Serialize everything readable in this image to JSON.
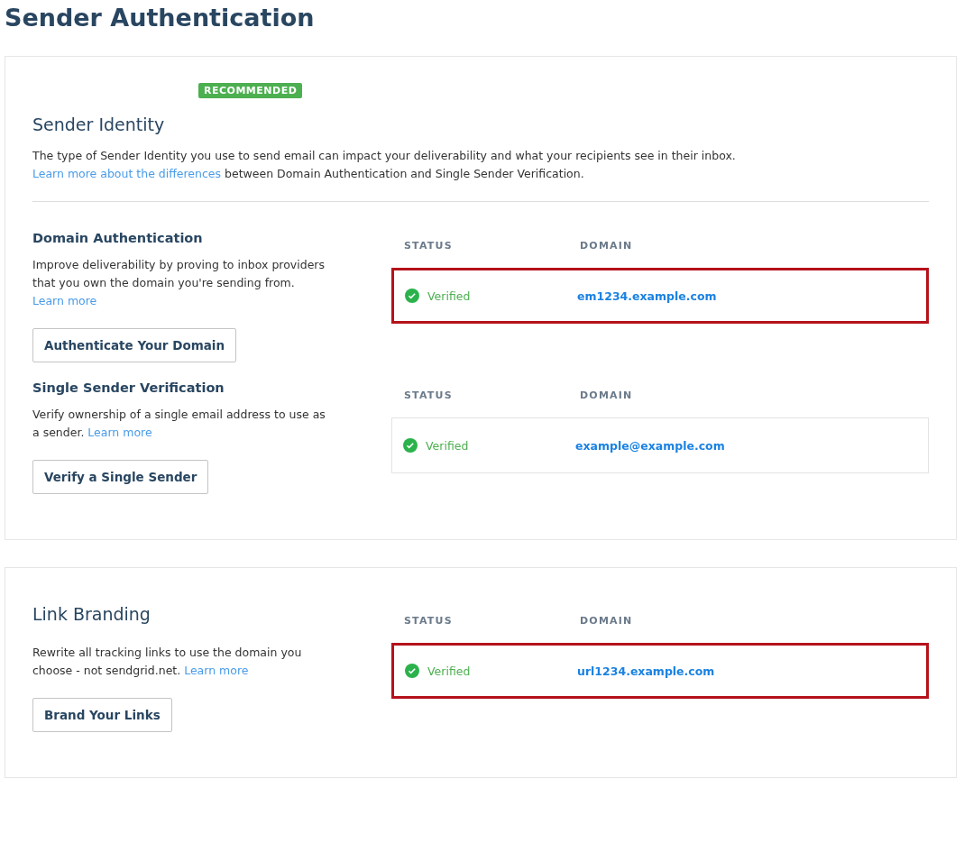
{
  "title": "Sender Authentication",
  "cards": [
    {
      "badge": "RECOMMENDED",
      "heading": "Sender Identity",
      "intro": "The type of Sender Identity you use to send email can impact your deliverability and what your recipients see in their inbox.",
      "intro_link": "Learn more about the differences",
      "intro_after": " between Domain Authentication and Single Sender Verification.",
      "features": [
        {
          "kind": "small",
          "heading": "Domain Authentication",
          "text": "Improve deliverability by proving to inbox providers that you own the domain you're sending from.",
          "link": "Learn more",
          "button": "Authenticate Your Domain",
          "columns": [
            "STATUS",
            "DOMAIN"
          ],
          "rows": [
            {
              "status": "Verified",
              "domain": "em1234.example.com",
              "highlighted": true
            }
          ]
        },
        {
          "kind": "small",
          "heading": "Single Sender Verification",
          "text": "Verify ownership of a single email address to use as a sender.",
          "link": "Learn more",
          "button": "Verify a Single Sender",
          "columns": [
            "STATUS",
            "DOMAIN"
          ],
          "rows": [
            {
              "status": "Verified",
              "domain": "example@example.com",
              "highlighted": false
            }
          ]
        }
      ]
    },
    {
      "features": [
        {
          "kind": "large",
          "heading": "Link Branding",
          "text": "Rewrite all tracking links to use the domain you choose - not sendgrid.net.",
          "link": "Learn more",
          "button": "Brand Your Links",
          "columns": [
            "STATUS",
            "DOMAIN"
          ],
          "rows": [
            {
              "status": "Verified",
              "domain": "url1234.example.com",
              "highlighted": true
            }
          ]
        }
      ]
    }
  ]
}
